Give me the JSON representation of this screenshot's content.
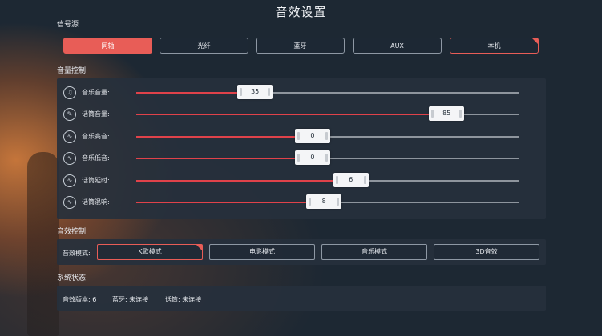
{
  "title": "音效设置",
  "sections": {
    "source": "信号源",
    "volume": "音量控制",
    "effect": "音效控制",
    "status": "系统状态"
  },
  "sources": [
    {
      "label": "同轴",
      "state": "active"
    },
    {
      "label": "光纤",
      "state": "normal"
    },
    {
      "label": "蓝牙",
      "state": "normal"
    },
    {
      "label": "AUX",
      "state": "normal"
    },
    {
      "label": "本机",
      "state": "marked"
    }
  ],
  "volumes": [
    {
      "label": "音乐音量:",
      "value": "35",
      "level": 0.31,
      "icon": "music-note-icon",
      "glyph": "♫"
    },
    {
      "label": "话筒音量:",
      "value": "85",
      "level": 0.81,
      "icon": "microphone-icon",
      "glyph": "✎"
    },
    {
      "label": "音乐高音:",
      "value": "0",
      "level": 0.46,
      "icon": "treble-wave-icon",
      "glyph": "∿"
    },
    {
      "label": "音乐低音:",
      "value": "0",
      "level": 0.46,
      "icon": "bass-wave-icon",
      "glyph": "∿"
    },
    {
      "label": "话筒延时:",
      "value": "6",
      "level": 0.56,
      "icon": "delay-wave-icon",
      "glyph": "∿"
    },
    {
      "label": "话筒混响:",
      "value": "8",
      "level": 0.49,
      "icon": "reverb-wave-icon",
      "glyph": "∿"
    }
  ],
  "effect": {
    "mode_label": "音效模式:",
    "modes": [
      {
        "label": "K歌模式",
        "selected": true
      },
      {
        "label": "电影模式",
        "selected": false
      },
      {
        "label": "音乐模式",
        "selected": false
      },
      {
        "label": "3D音效",
        "selected": false
      }
    ]
  },
  "status": {
    "version": "音效版本: 6",
    "bluetooth": "蓝牙: 未连接",
    "mic": "话筒: 未连接"
  },
  "colors": {
    "accent": "#e85d57",
    "slider_fill": "#e0424a",
    "background": "#1d2833",
    "panel": "#26303c"
  }
}
